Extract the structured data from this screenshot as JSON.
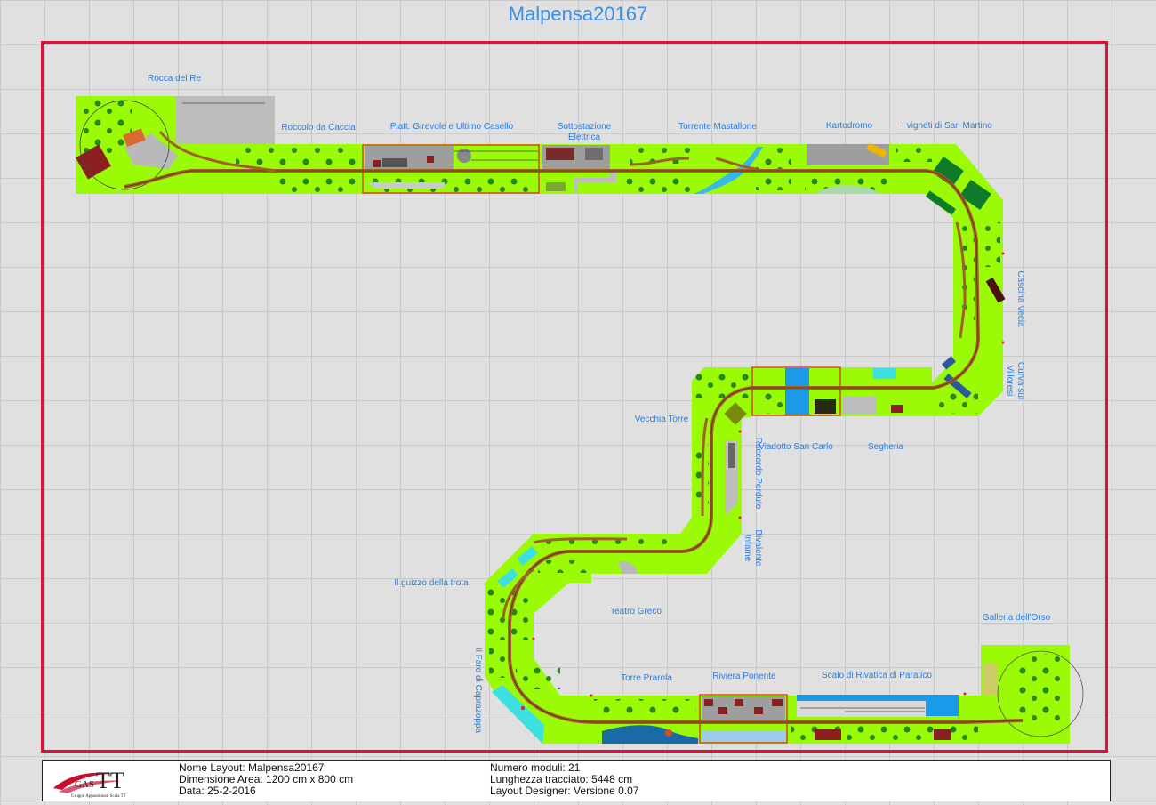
{
  "title": "Malpensa20167",
  "labels": {
    "rocca": "Rocca del Re",
    "roccolo": "Roccolo da Caccia",
    "piatt": "Piatt. Girevole e Ultimo Casello",
    "sotto1": "Sottostazione",
    "sotto2": "Elettrica",
    "torrente": "Torrente Mastallone",
    "kartodromo": "Kartodromo",
    "vigneti": "I vigneti di San Martino",
    "cascina": "Cascina Vecia",
    "curva1": "Curva sul",
    "curva2": "Villoresi",
    "vecchia": "Vecchia Torre",
    "viadotto": "Viadotto San Carlo",
    "segheria": "Segheria",
    "raccordo": "Raccordo Perduto",
    "bivalente1": "Bivalente",
    "bivalente2": "Infame",
    "guizzo": "Il guizzo della trota",
    "teatro": "Teatro Greco",
    "galleria": "Galleria dell'Orso",
    "faro": "Il Faro di Caprazoppa",
    "torre_prarola": "Torre Prarola",
    "riviera": "Riviera Ponente",
    "scalo": "Scalo di Rivatica di Paratico"
  },
  "info": {
    "nome": "Nome Layout: Malpensa20167",
    "dimensione": "Dimensione Area: 1200 cm x 800 cm",
    "data": "Data: 25-2-2016",
    "moduli": "Numero moduli: 21",
    "lunghezza": "Lunghezza tracciato: 5448 cm",
    "designer": "Layout Designer: Versione 0.07"
  },
  "logo": {
    "text": "GAS",
    "tt": "TT",
    "subtitle": "Gruppo Appassionati Scala TT"
  },
  "colors": {
    "board": "#9bfb06",
    "track": "#a0602a",
    "frame": "#e0103a",
    "label": "#2a7de0",
    "tree": "#1a7a1a"
  }
}
